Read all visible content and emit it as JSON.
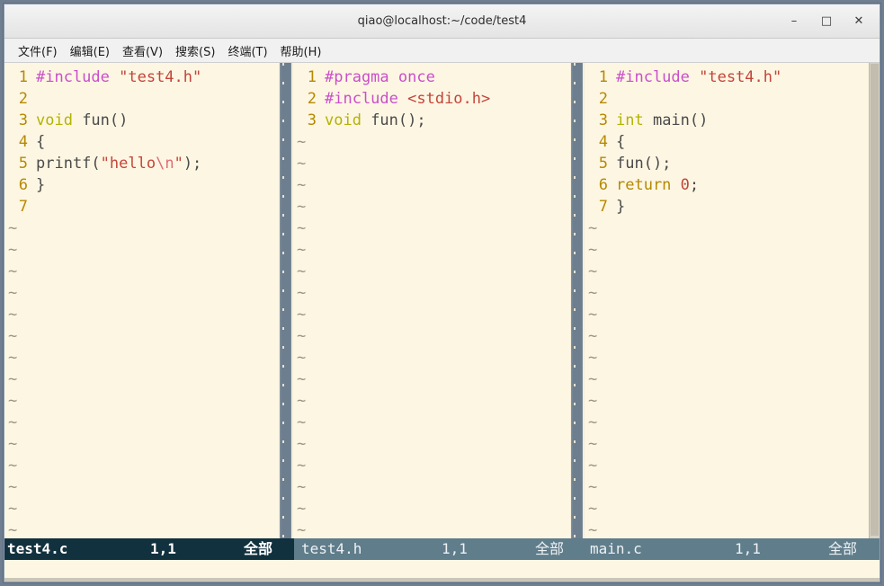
{
  "window": {
    "title": "qiao@localhost:~/code/test4",
    "controls": [
      {
        "name": "minimize",
        "glyph": "–"
      },
      {
        "name": "maximize",
        "glyph": "□"
      },
      {
        "name": "close",
        "glyph": "✕"
      }
    ]
  },
  "menubar": {
    "items": [
      {
        "label": "文件(F)"
      },
      {
        "label": "编辑(E)"
      },
      {
        "label": "查看(V)"
      },
      {
        "label": "搜索(S)"
      },
      {
        "label": "终端(T)"
      },
      {
        "label": "帮助(H)"
      }
    ]
  },
  "colors": {
    "background": "#fdf6e3",
    "preprocessor": "#c94fc9",
    "string": "#c3453a",
    "escape": "#e06c75",
    "type": "#b3b300",
    "keyword": "#b58900",
    "linenumber": "#b58900",
    "plain": "#4a4a4a",
    "status_active_bg": "#12313f",
    "status_inactive_bg": "#607d8b",
    "tilde": "#9a9580",
    "split": "#6d7e8e"
  },
  "panes": [
    {
      "id": "pane-test4-c",
      "filename": "test4.c",
      "active": true,
      "lines": [
        {
          "n": "1",
          "tokens": [
            {
              "t": "#include ",
              "c": "pre"
            },
            {
              "t": "\"test4.h\"",
              "c": "str"
            }
          ]
        },
        {
          "n": "2",
          "tokens": []
        },
        {
          "n": "3",
          "tokens": [
            {
              "t": "void",
              "c": "type"
            },
            {
              "t": " fun()",
              "c": "plain"
            }
          ]
        },
        {
          "n": "4",
          "tokens": [
            {
              "t": "{",
              "c": "plain"
            }
          ]
        },
        {
          "n": "5",
          "tokens": [
            {
              "t": "printf(",
              "c": "plain"
            },
            {
              "t": "\"hello",
              "c": "str"
            },
            {
              "t": "\\n",
              "c": "esc"
            },
            {
              "t": "\"",
              "c": "str"
            },
            {
              "t": ");",
              "c": "plain"
            }
          ]
        },
        {
          "n": "6",
          "tokens": [
            {
              "t": "}",
              "c": "plain"
            }
          ]
        },
        {
          "n": "7",
          "tokens": []
        }
      ],
      "tilde_count": 15,
      "tilde": "~",
      "status": {
        "name": "test4.c",
        "position": "1,1",
        "percent": "全部"
      }
    },
    {
      "id": "pane-test4-h",
      "filename": "test4.h",
      "active": false,
      "lines": [
        {
          "n": "1",
          "tokens": [
            {
              "t": "#pragma once",
              "c": "pre"
            }
          ]
        },
        {
          "n": "2",
          "tokens": [
            {
              "t": "#include ",
              "c": "pre"
            },
            {
              "t": "<stdio.h>",
              "c": "str"
            }
          ]
        },
        {
          "n": "3",
          "tokens": [
            {
              "t": "void",
              "c": "type"
            },
            {
              "t": " fun();",
              "c": "plain"
            }
          ]
        }
      ],
      "tilde_count": 19,
      "tilde": "~",
      "status": {
        "name": "test4.h",
        "position": "1,1",
        "percent": "全部"
      }
    },
    {
      "id": "pane-main-c",
      "filename": "main.c",
      "active": false,
      "lines": [
        {
          "n": "1",
          "tokens": [
            {
              "t": "#include ",
              "c": "pre"
            },
            {
              "t": "\"test4.h\"",
              "c": "str"
            }
          ]
        },
        {
          "n": "2",
          "tokens": []
        },
        {
          "n": "3",
          "tokens": [
            {
              "t": "int",
              "c": "type"
            },
            {
              "t": " main()",
              "c": "plain"
            }
          ]
        },
        {
          "n": "4",
          "tokens": [
            {
              "t": "{",
              "c": "plain"
            }
          ]
        },
        {
          "n": "5",
          "tokens": [
            {
              "t": "fun();",
              "c": "plain"
            }
          ]
        },
        {
          "n": "6",
          "tokens": [
            {
              "t": "return",
              "c": "kw"
            },
            {
              "t": " ",
              "c": "plain"
            },
            {
              "t": "0",
              "c": "num"
            },
            {
              "t": ";",
              "c": "plain"
            }
          ]
        },
        {
          "n": "7",
          "tokens": [
            {
              "t": "}",
              "c": "plain"
            }
          ]
        }
      ],
      "tilde_count": 15,
      "tilde": "~",
      "status": {
        "name": "main.c",
        "position": "1,1",
        "percent": "全部"
      }
    }
  ],
  "cmdline": {
    "text": ""
  }
}
